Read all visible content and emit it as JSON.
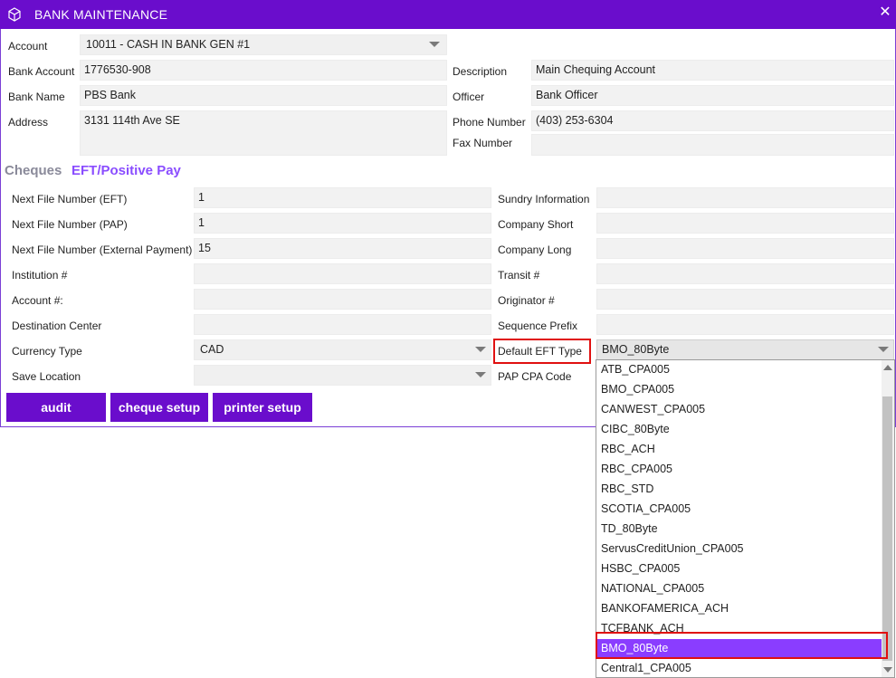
{
  "window": {
    "title": "BANK MAINTENANCE",
    "icon": "cube-icon",
    "close_glyph": "✕"
  },
  "header_form": {
    "account_label": "Account",
    "account_value": "10011 - CASH IN BANK GEN #1",
    "bank_account_label": "Bank Account",
    "bank_account_value": "1776530-908",
    "bank_name_label": "Bank Name",
    "bank_name_value": "PBS Bank",
    "address_label": "Address",
    "address_value": "3131 114th Ave SE",
    "description_label": "Description",
    "description_value": "Main Chequing Account",
    "officer_label": "Officer",
    "officer_value": "Bank Officer",
    "phone_label": "Phone Number",
    "phone_value": "(403) 253-6304",
    "fax_label": "Fax Number",
    "fax_value": ""
  },
  "tabs": {
    "cheques": "Cheques",
    "eft": "EFT/Positive Pay",
    "active": "eft"
  },
  "eft_form": {
    "next_file_eft_label": "Next File Number (EFT)",
    "next_file_eft_value": "1",
    "next_file_pap_label": "Next File Number (PAP)",
    "next_file_pap_value": "1",
    "next_file_ext_label": "Next File Number (External Payment)",
    "next_file_ext_value": "15",
    "institution_label": "Institution #",
    "institution_value": "",
    "account_no_label": "Account #:",
    "account_no_value": "",
    "destination_label": "Destination Center",
    "destination_value": "",
    "currency_label": "Currency Type",
    "currency_value": "CAD",
    "save_location_label": "Save Location",
    "save_location_value": "",
    "sundry_label": "Sundry Information",
    "sundry_value": "",
    "company_short_label": "Company Short",
    "company_short_value": "",
    "company_long_label": "Company Long",
    "company_long_value": "",
    "transit_label": "Transit #",
    "transit_value": "",
    "originator_label": "Originator #",
    "originator_value": "",
    "sequence_prefix_label": "Sequence Prefix",
    "sequence_prefix_value": "",
    "default_eft_label": "Default EFT Type",
    "default_eft_value": "BMO_80Byte",
    "pap_cpa_label": "PAP CPA Code"
  },
  "buttons": {
    "audit": "audit",
    "cheque_setup": "cheque setup",
    "printer_setup": "printer setup"
  },
  "eft_type_dropdown": {
    "options": [
      "ATB_CPA005",
      "BMO_CPA005",
      "CANWEST_CPA005",
      "CIBC_80Byte",
      "RBC_ACH",
      "RBC_CPA005",
      "RBC_STD",
      "SCOTIA_CPA005",
      "TD_80Byte",
      "ServusCreditUnion_CPA005",
      "HSBC_CPA005",
      "NATIONAL_CPA005",
      "BANKOFAMERICA_ACH",
      "TCFBANK_ACH",
      "BMO_80Byte",
      "Central1_CPA005"
    ],
    "selected_index": 14
  },
  "colors": {
    "accent": "#6a0dcc",
    "tab_active": "#8a4dff",
    "highlight": "#e01010",
    "selected_item": "#8a3dff"
  }
}
